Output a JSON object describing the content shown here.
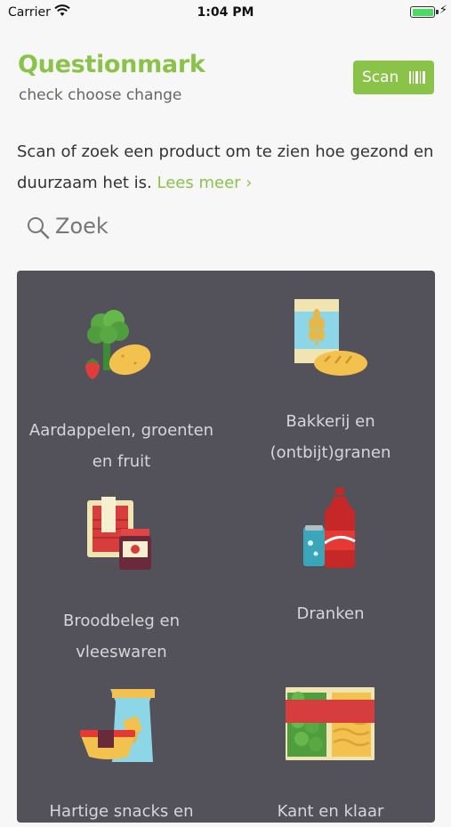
{
  "status_bar": {
    "carrier": "Carrier",
    "time": "1:04 PM"
  },
  "header": {
    "brand": "Questionmark",
    "tagline": "check choose change",
    "scan_label": "Scan"
  },
  "intro": {
    "text": "Scan of zoek een product om te zien hoe gezond en duurzaam het is.",
    "link": "Lees meer ›"
  },
  "search": {
    "placeholder": "Zoek"
  },
  "categories": [
    {
      "name": "Aardappelen, groenten en fruit",
      "icon": "vegetables-icon"
    },
    {
      "name": "Bakkerij en (ontbijt)granen",
      "icon": "bakery-icon"
    },
    {
      "name": "Broodbeleg en vleeswaren",
      "icon": "sandwich-spread-icon"
    },
    {
      "name": "Dranken",
      "icon": "drinks-icon"
    },
    {
      "name": "Hartige snacks en",
      "icon": "snacks-icon"
    },
    {
      "name": "Kant en klaar",
      "icon": "ready-meal-icon"
    }
  ],
  "colors": {
    "accent": "#8bc34a",
    "panel": "#53525a"
  }
}
